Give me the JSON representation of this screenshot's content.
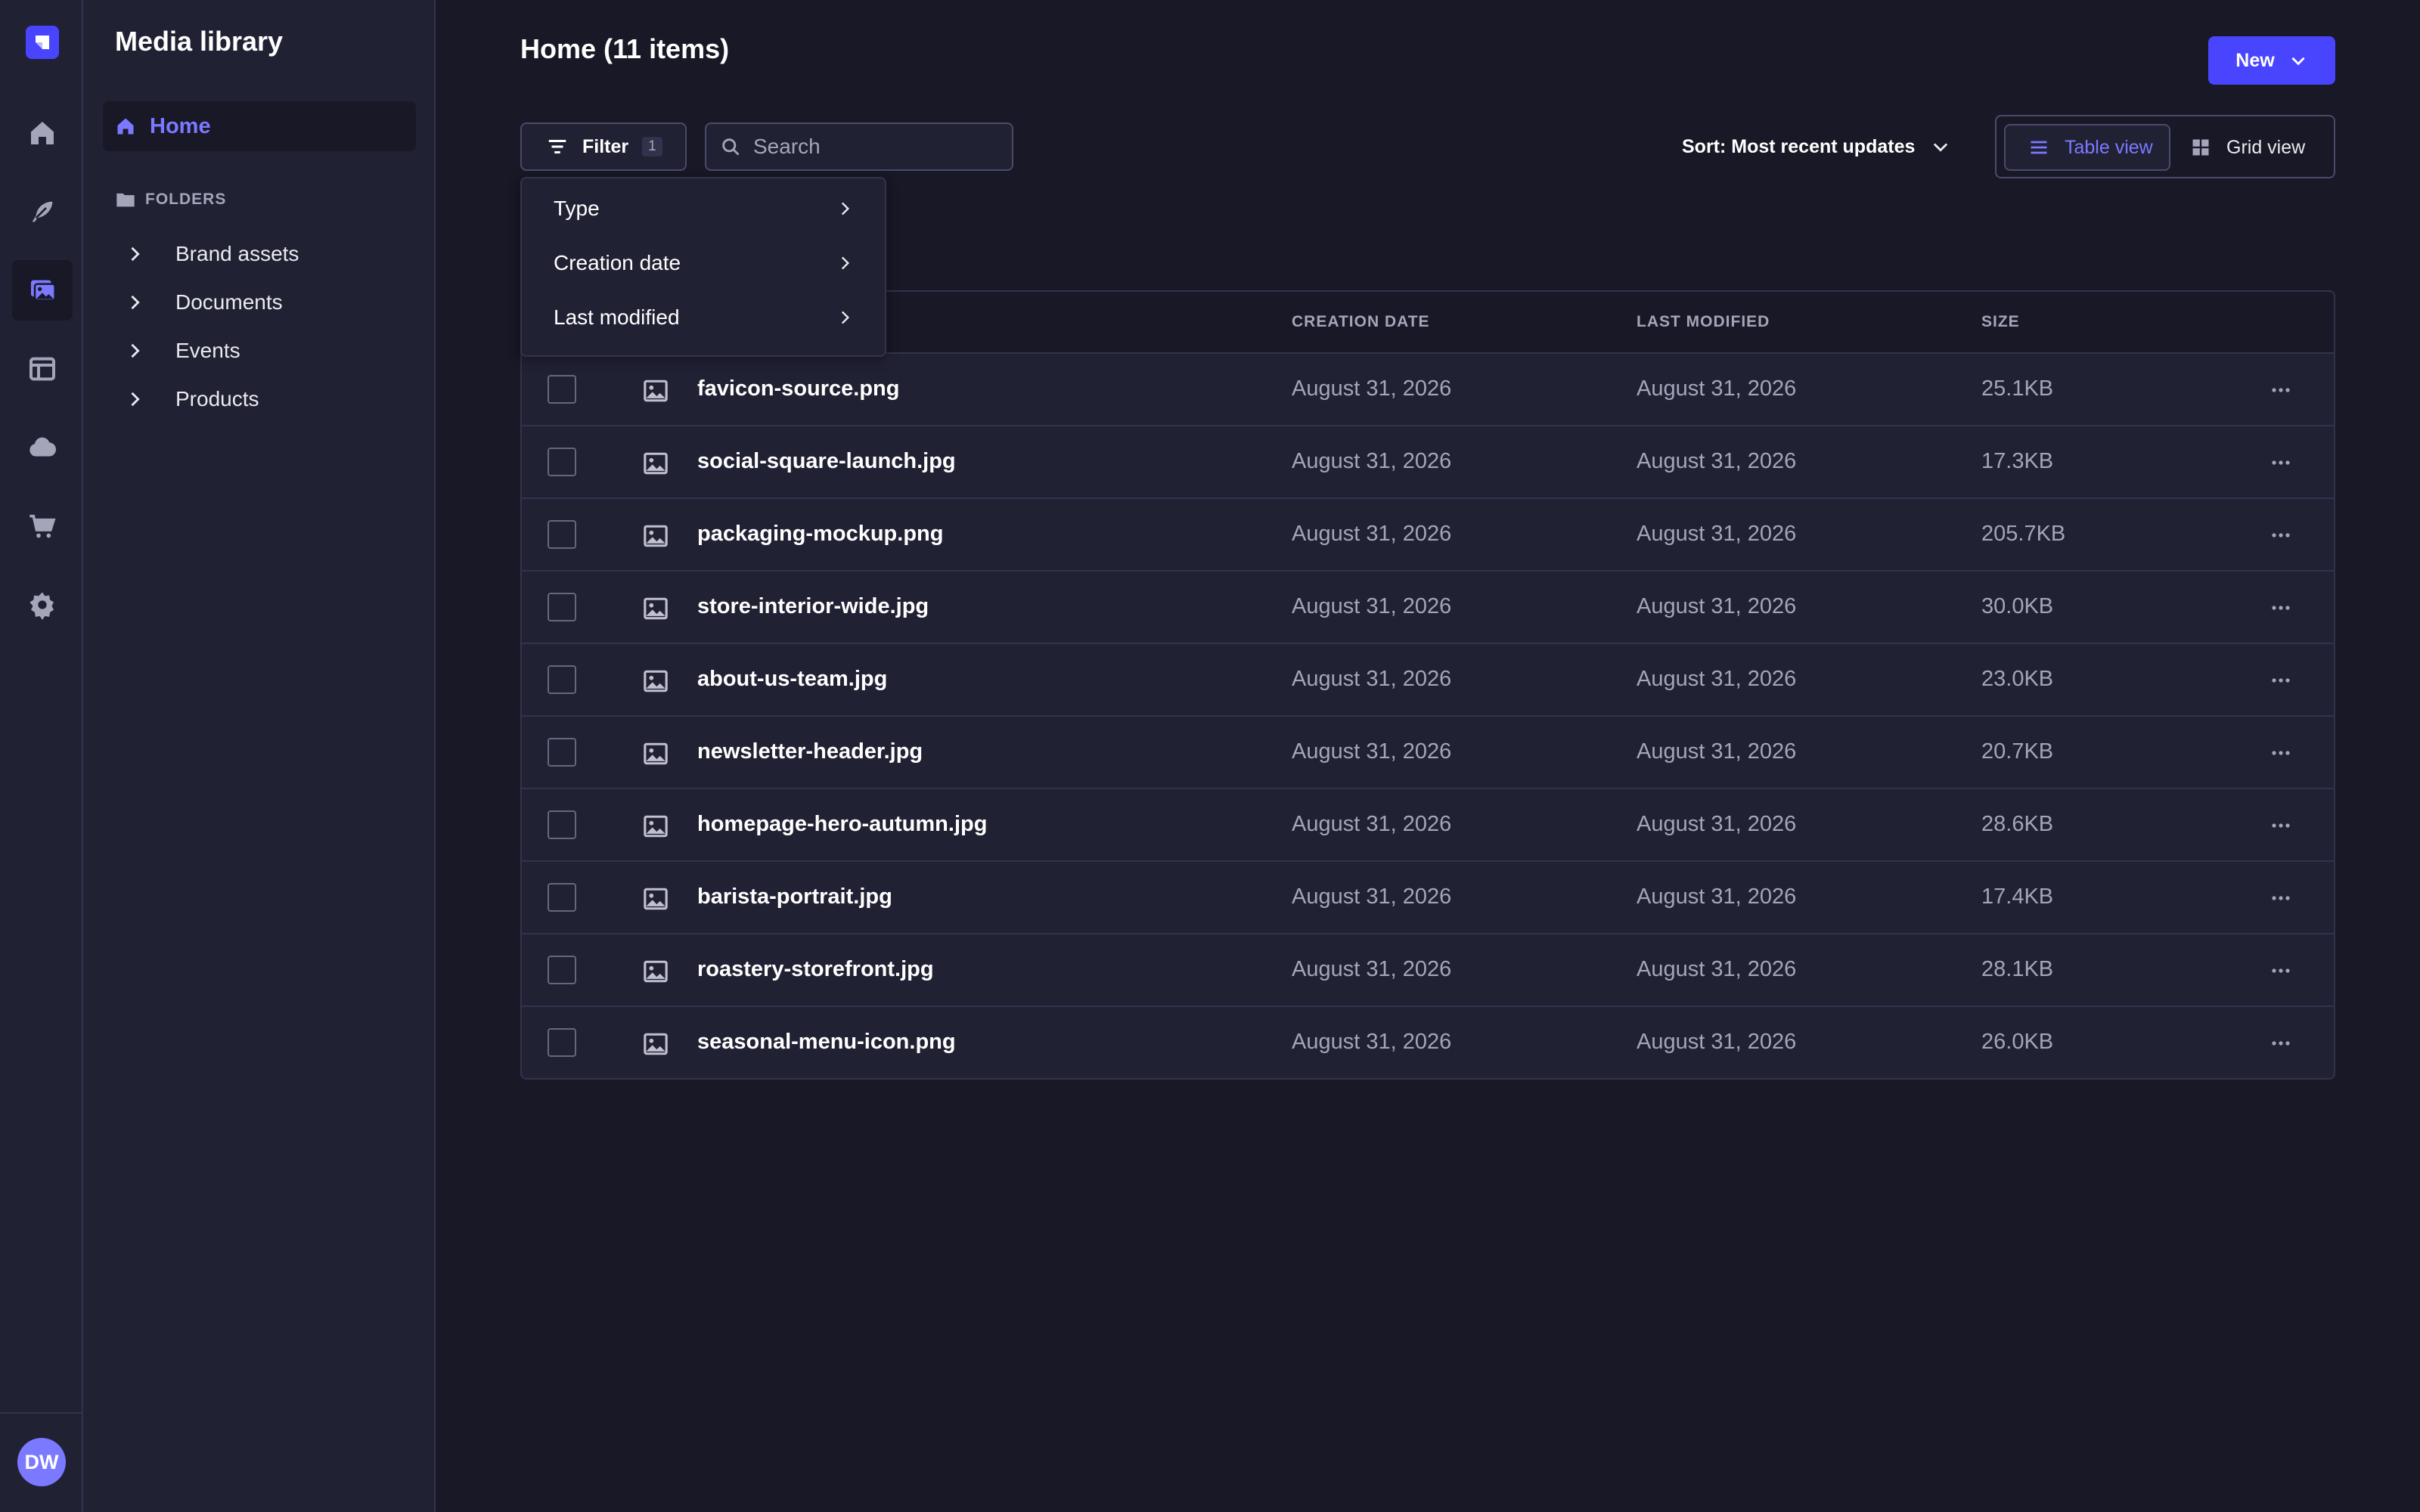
{
  "app": {
    "logo_icon": "strapi-logo-icon",
    "nav_icons": [
      "home-icon",
      "feather-icon",
      "media-library-icon",
      "layout-icon",
      "cloud-icon",
      "cart-icon",
      "settings-icon"
    ],
    "active_nav": "media-library-icon",
    "user_initials": "DW"
  },
  "sidebar": {
    "title": "Media library",
    "home_label": "Home",
    "folders_heading": "FOLDERS",
    "folders": [
      {
        "label": "Brand assets"
      },
      {
        "label": "Documents"
      },
      {
        "label": "Events"
      },
      {
        "label": "Products"
      }
    ]
  },
  "header": {
    "title": "Home (11 items)",
    "new_button": "New"
  },
  "toolbar": {
    "filter_label": "Filter",
    "filter_count": "1",
    "search_placeholder": "Search",
    "sort_label": "Sort: Most recent updates",
    "table_view_label": "Table view",
    "grid_view_label": "Grid view",
    "active_view": "table"
  },
  "filter_menu": {
    "items": [
      {
        "label": "Type"
      },
      {
        "label": "Creation date"
      },
      {
        "label": "Last modified"
      }
    ]
  },
  "table": {
    "columns": {
      "creation_date": "CREATION DATE",
      "last_modified": "LAST MODIFIED",
      "size": "SIZE"
    },
    "rows": [
      {
        "name": "favicon-source.png",
        "created": "August 31, 2026",
        "modified": "August 31, 2026",
        "size": "25.1KB"
      },
      {
        "name": "social-square-launch.jpg",
        "created": "August 31, 2026",
        "modified": "August 31, 2026",
        "size": "17.3KB"
      },
      {
        "name": "packaging-mockup.png",
        "created": "August 31, 2026",
        "modified": "August 31, 2026",
        "size": "205.7KB"
      },
      {
        "name": "store-interior-wide.jpg",
        "created": "August 31, 2026",
        "modified": "August 31, 2026",
        "size": "30.0KB"
      },
      {
        "name": "about-us-team.jpg",
        "created": "August 31, 2026",
        "modified": "August 31, 2026",
        "size": "23.0KB"
      },
      {
        "name": "newsletter-header.jpg",
        "created": "August 31, 2026",
        "modified": "August 31, 2026",
        "size": "20.7KB"
      },
      {
        "name": "homepage-hero-autumn.jpg",
        "created": "August 31, 2026",
        "modified": "August 31, 2026",
        "size": "28.6KB"
      },
      {
        "name": "barista-portrait.jpg",
        "created": "August 31, 2026",
        "modified": "August 31, 2026",
        "size": "17.4KB"
      },
      {
        "name": "roastery-storefront.jpg",
        "created": "August 31, 2026",
        "modified": "August 31, 2026",
        "size": "28.1KB"
      },
      {
        "name": "seasonal-menu-icon.png",
        "created": "August 31, 2026",
        "modified": "August 31, 2026",
        "size": "26.0KB"
      }
    ]
  },
  "colors": {
    "background": "#181826",
    "panel": "#212134",
    "border": "#32324d",
    "accent": "#4945ff",
    "accent_light": "#7b79ff",
    "muted_text": "#a5a5ba"
  }
}
